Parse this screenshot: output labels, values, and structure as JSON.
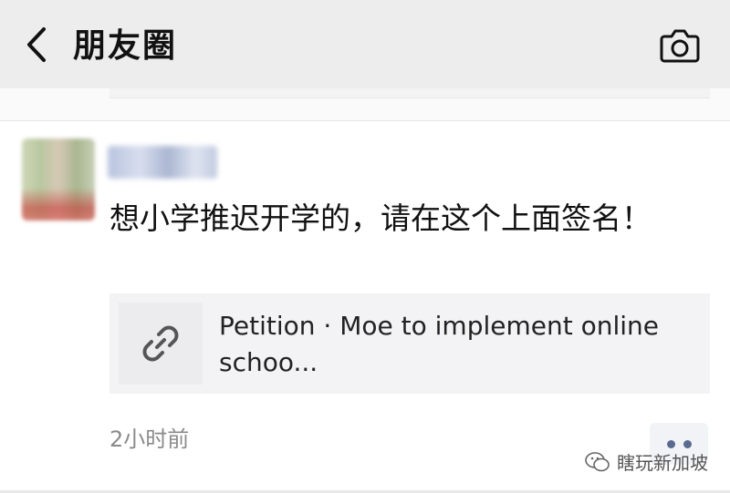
{
  "header": {
    "title": "朋友圈",
    "back_icon": "chevron-left-icon",
    "camera_icon": "camera-icon"
  },
  "post": {
    "text": "想小学推迟开学的，请在这个上面签名！",
    "link_card": {
      "icon": "link-icon",
      "title": "Petition · Moe to implement online schoo..."
    },
    "timestamp": "2小时前",
    "more_icon": "more-dots-icon"
  },
  "watermark": {
    "icon": "wechat-icon",
    "text": "瞎玩新加坡"
  },
  "colors": {
    "header_bg": "#ededed",
    "link_card_bg": "#f3f3f5",
    "timestamp": "#8a8a8a",
    "more_dots": "#5a6b90"
  }
}
